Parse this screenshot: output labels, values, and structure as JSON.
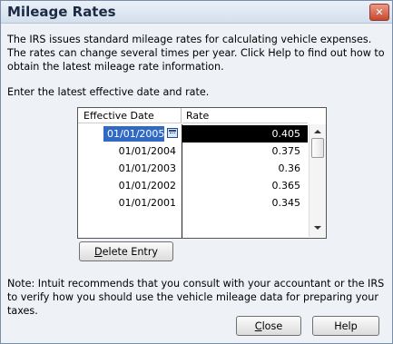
{
  "dialog": {
    "title": "Mileage Rates",
    "description": "The IRS issues standard mileage rates for calculating vehicle expenses.  The rates can change several times per year.  Click Help to find out how to obtain the latest mileage rate information.",
    "prompt": "Enter the latest effective date and rate.",
    "note": "Note: Intuit recommends that you consult with your accountant or the IRS to verify how you should use the vehicle mileage data for preparing your taxes."
  },
  "table": {
    "columns": [
      "Effective Date",
      "Rate"
    ],
    "rows": [
      {
        "date": "01/01/2005",
        "rate": "0.405"
      },
      {
        "date": "01/01/2004",
        "rate": "0.375"
      },
      {
        "date": "01/01/2003",
        "rate": "0.36"
      },
      {
        "date": "01/01/2002",
        "rate": "0.365"
      },
      {
        "date": "01/01/2001",
        "rate": "0.345"
      }
    ]
  },
  "buttons": {
    "delete_first": "D",
    "delete_rest": "elete Entry",
    "close_first": "C",
    "close_rest": "lose",
    "help": "Help",
    "close_x": "✕"
  }
}
